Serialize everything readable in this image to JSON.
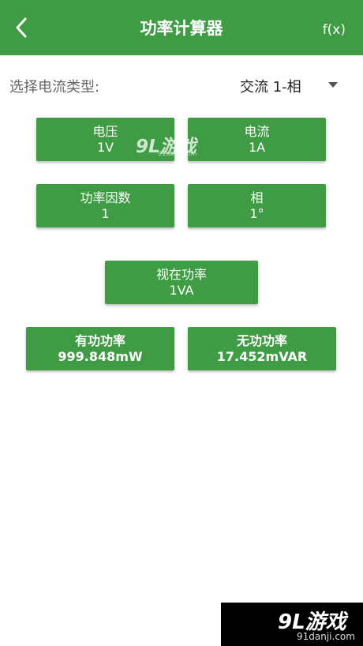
{
  "header": {
    "title": "功率计算器",
    "fx_label": "f(x)"
  },
  "current_type": {
    "label": "选择电流类型:",
    "selected": "交流 1-相"
  },
  "buttons": {
    "voltage": {
      "label": "电压",
      "value": "1V"
    },
    "current": {
      "label": "电流",
      "value": "1A"
    },
    "power_factor": {
      "label": "功率因数",
      "value": "1"
    },
    "phase": {
      "label": "相",
      "value": "1°"
    },
    "apparent_power": {
      "label": "视在功率",
      "value": "1VA"
    },
    "active_power": {
      "label": "有功功率",
      "value": "999.848mW"
    },
    "reactive_power": {
      "label": "无功功率",
      "value": "17.452mVAR"
    }
  },
  "watermark": {
    "brand": "9L游戏",
    "domain": "91danji.com"
  },
  "colors": {
    "primary": "#3f9c44",
    "background": "#ffffff"
  }
}
